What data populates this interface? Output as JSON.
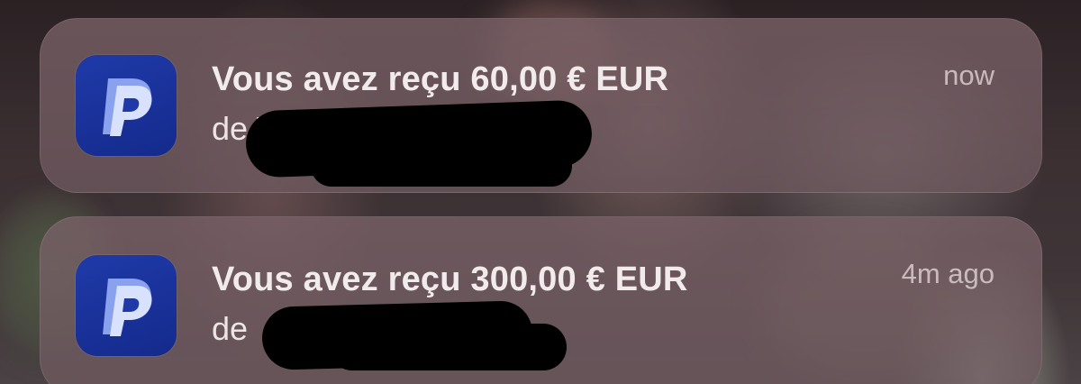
{
  "notifications": [
    {
      "app_icon": "paypal-icon",
      "title": "Vous avez reçu 60,00 € EUR",
      "body_visible": "de Th",
      "time": "now"
    },
    {
      "app_icon": "paypal-icon",
      "title": "Vous avez reçu 300,00 € EUR",
      "body_visible": "de",
      "time": "4m ago"
    }
  ],
  "colors": {
    "paypal_blue": "#1f3aa8",
    "paypal_light": "#b9c8f4"
  }
}
